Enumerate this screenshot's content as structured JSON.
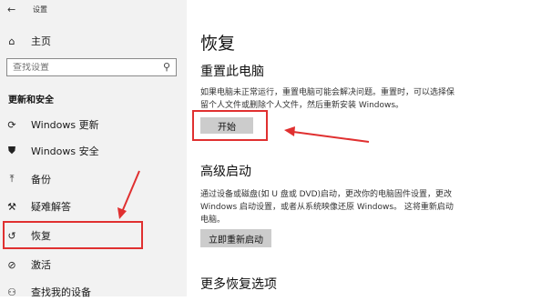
{
  "window": {
    "title": "设置",
    "back_glyph": "←"
  },
  "sidebar": {
    "home": {
      "label": "主页",
      "icon": "home-icon",
      "glyph": "⌂"
    },
    "search": {
      "placeholder": "查找设置",
      "icon": "search-icon",
      "glyph": "⚲"
    },
    "section_heading": "更新和安全",
    "items": [
      {
        "label": "Windows 更新",
        "icon": "sync-icon",
        "glyph": "⟳"
      },
      {
        "label": "Windows 安全",
        "icon": "shield-icon",
        "glyph": "⛊"
      },
      {
        "label": "备份",
        "icon": "backup-arrow-icon",
        "glyph": "⤒"
      },
      {
        "label": "疑难解答",
        "icon": "wrench-icon",
        "glyph": "⚒"
      },
      {
        "label": "恢复",
        "icon": "history-icon",
        "glyph": "↺",
        "selected": true
      },
      {
        "label": "激活",
        "icon": "check-circle-icon",
        "glyph": "⊘"
      },
      {
        "label": "查找我的设备",
        "icon": "person-location-icon",
        "glyph": "⚇"
      }
    ]
  },
  "main": {
    "title": "恢复",
    "reset": {
      "heading": "重置此电脑",
      "description": "如果电脑未正常运行，重置电脑可能会解决问题。重置时，可以选择保留个人文件或删除个人文件，然后重新安装 Windows。",
      "button_label": "开始"
    },
    "advanced": {
      "heading": "高级启动",
      "description": "通过设备或磁盘(如 U 盘或 DVD)启动，更改你的电脑固件设置，更改 Windows 启动设置，或者从系统映像还原 Windows。 这将重新启动电脑。",
      "button_label": "立即重新启动"
    },
    "more_heading": "更多恢复选项"
  },
  "annotation_color": "#e03030"
}
